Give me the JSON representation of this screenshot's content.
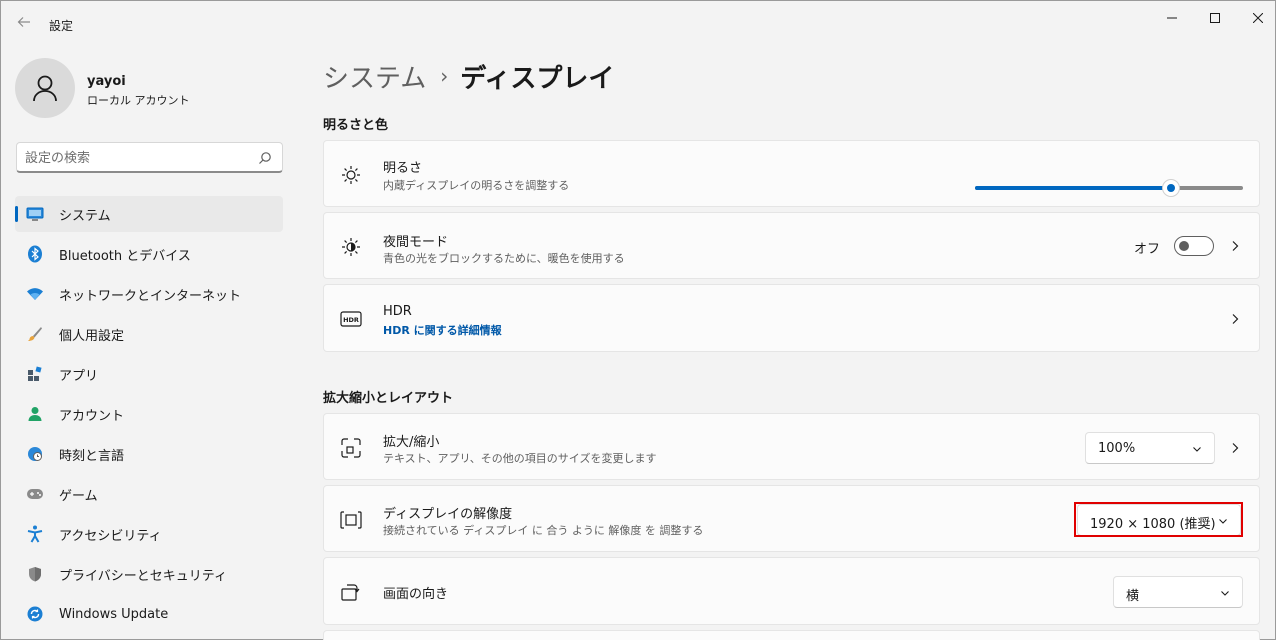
{
  "window": {
    "app_title": "設定"
  },
  "profile": {
    "name": "yayoi",
    "account_type": "ローカル アカウント"
  },
  "search": {
    "placeholder": "設定の検索"
  },
  "sidebar": {
    "items": [
      {
        "label": "システム",
        "icon": "display-icon",
        "active": true
      },
      {
        "label": "Bluetooth とデバイス",
        "icon": "bluetooth-icon",
        "active": false
      },
      {
        "label": "ネットワークとインターネット",
        "icon": "wifi-icon",
        "active": false
      },
      {
        "label": "個人用設定",
        "icon": "brush-icon",
        "active": false
      },
      {
        "label": "アプリ",
        "icon": "apps-icon",
        "active": false
      },
      {
        "label": "アカウント",
        "icon": "person-icon",
        "active": false
      },
      {
        "label": "時刻と言語",
        "icon": "globe-clock-icon",
        "active": false
      },
      {
        "label": "ゲーム",
        "icon": "gamepad-icon",
        "active": false
      },
      {
        "label": "アクセシビリティ",
        "icon": "accessibility-icon",
        "active": false
      },
      {
        "label": "プライバシーとセキュリティ",
        "icon": "shield-icon",
        "active": false
      },
      {
        "label": "Windows Update",
        "icon": "update-icon",
        "active": false
      }
    ]
  },
  "breadcrumb": {
    "parent": "システム",
    "separator": "›",
    "current": "ディスプレイ"
  },
  "sections": {
    "brightness_color": "明るさと色",
    "scale_layout": "拡大縮小とレイアウト"
  },
  "brightness": {
    "title": "明るさ",
    "subtitle": "内蔵ディスプレイの明るさを調整する",
    "level_percent": 73
  },
  "night_light": {
    "title": "夜間モード",
    "subtitle": "青色の光をブロックするために、暖色を使用する",
    "state_label": "オフ",
    "enabled": false
  },
  "hdr": {
    "title": "HDR",
    "link": "HDR に関する詳細情報",
    "icon_text": "HDR"
  },
  "scale": {
    "title": "拡大/縮小",
    "subtitle": "テキスト、アプリ、その他の項目のサイズを変更します",
    "value": "100%"
  },
  "resolution": {
    "title": "ディスプレイの解像度",
    "subtitle": "接続されている ディスプレイ に 合う ように 解像度 を 調整する",
    "value": "1920 × 1080 (推奨)"
  },
  "orientation": {
    "title": "画面の向き",
    "value": "横"
  },
  "colors": {
    "accent": "#0067c0",
    "highlight": "#e00000",
    "background": "#f3f3f3",
    "card": "#fbfbfb"
  }
}
